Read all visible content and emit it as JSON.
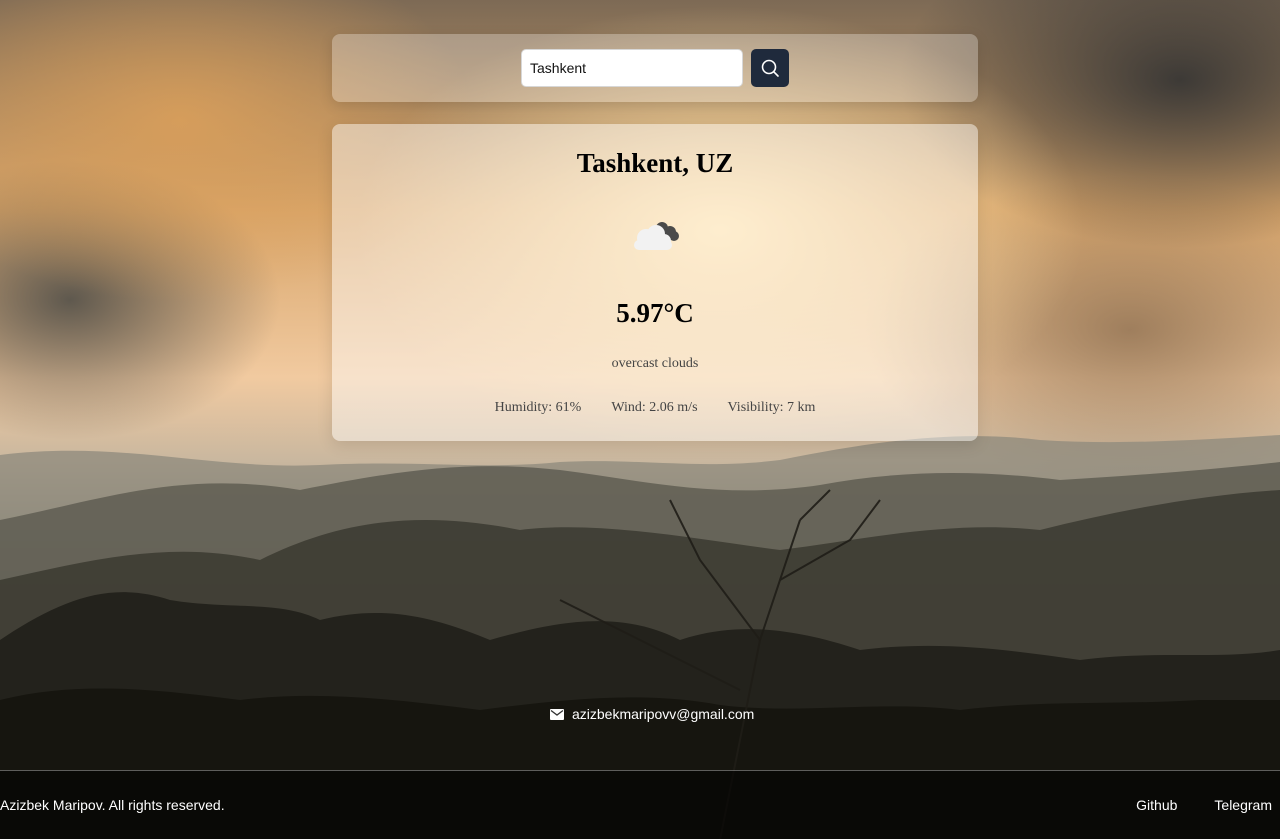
{
  "search": {
    "value": "Tashkent"
  },
  "weather": {
    "location": "Tashkent, UZ",
    "icon": "overcast-clouds-icon",
    "temperature": "5.97°C",
    "description": "overcast clouds",
    "humidity": "Humidity: 61%",
    "wind": "Wind: 2.06 m/s",
    "visibility": "Visibility: 7 km"
  },
  "contact": {
    "icon": "mail-icon",
    "email": "azizbekmaripovv@gmail.com"
  },
  "footer": {
    "copyright": "Azizbek Maripov. All rights reserved.",
    "links": [
      {
        "label": "Github"
      },
      {
        "label": "Telegram"
      }
    ]
  }
}
